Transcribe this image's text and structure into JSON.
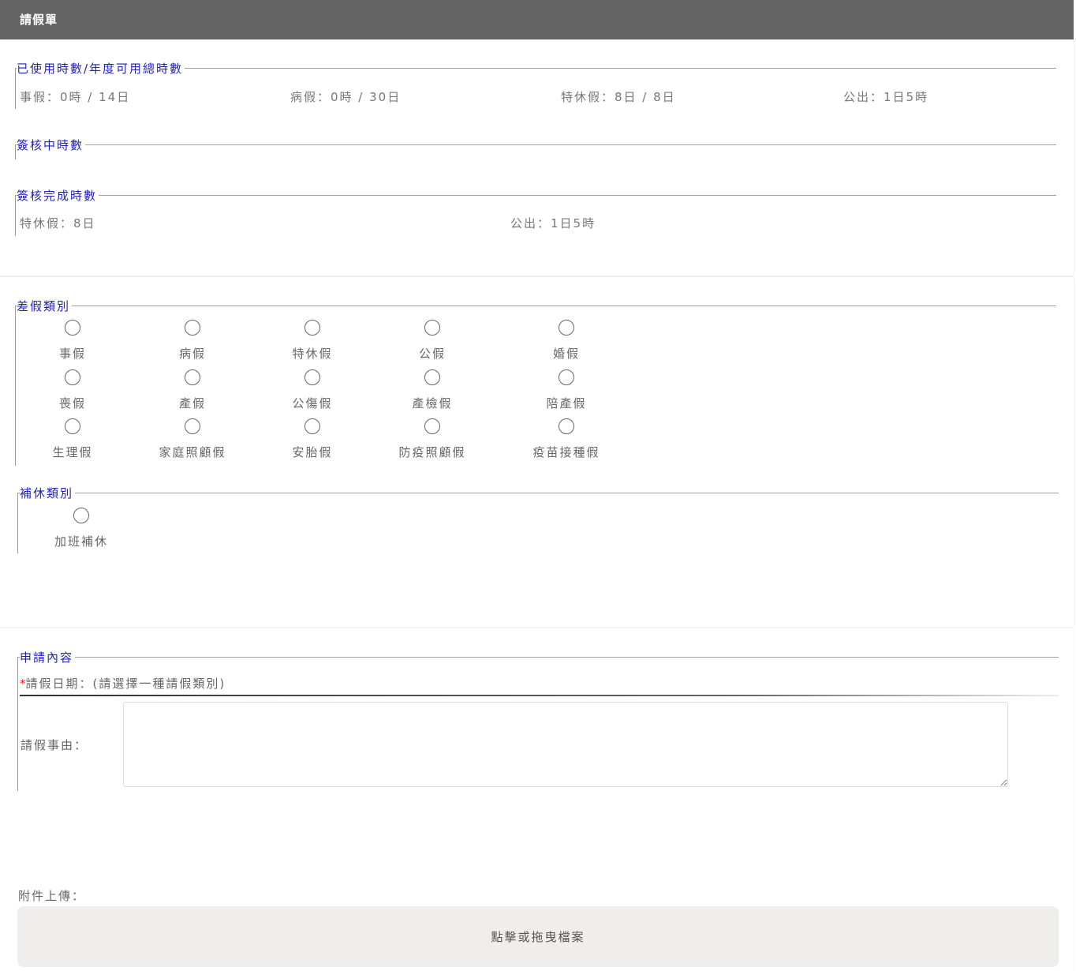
{
  "header": {
    "title": "請假單"
  },
  "usage": {
    "legend": "已使用時數/年度可用總時數",
    "items": [
      {
        "label": "事假：0時 / 14日"
      },
      {
        "label": "病假：0時 / 30日"
      },
      {
        "label": "特休假：8日 / 8日"
      },
      {
        "label": "公出：1日5時"
      }
    ]
  },
  "pending": {
    "legend": "簽核中時數"
  },
  "completed": {
    "legend": "簽核完成時數",
    "items": [
      {
        "label": "特休假：8日"
      },
      {
        "label": "公出：1日5時"
      }
    ]
  },
  "leave_types": {
    "legend": "差假類別",
    "options": [
      "事假",
      "病假",
      "特休假",
      "公假",
      "婚假",
      "喪假",
      "產假",
      "公傷假",
      "產檢假",
      "陪產假",
      "生理假",
      "家庭照顧假",
      "安胎假",
      "防疫照顧假",
      "疫苗接種假"
    ]
  },
  "comp_types": {
    "legend": "補休類別",
    "options": [
      "加班補休"
    ]
  },
  "application": {
    "legend": "申請內容",
    "required_mark": "*",
    "date_label": "請假日期：(請選擇一種請假類別)",
    "reason_label": "請假事由：",
    "reason_value": ""
  },
  "attachment": {
    "label": "附件上傳：",
    "dropzone_text": "點擊或拖曳檔案"
  }
}
